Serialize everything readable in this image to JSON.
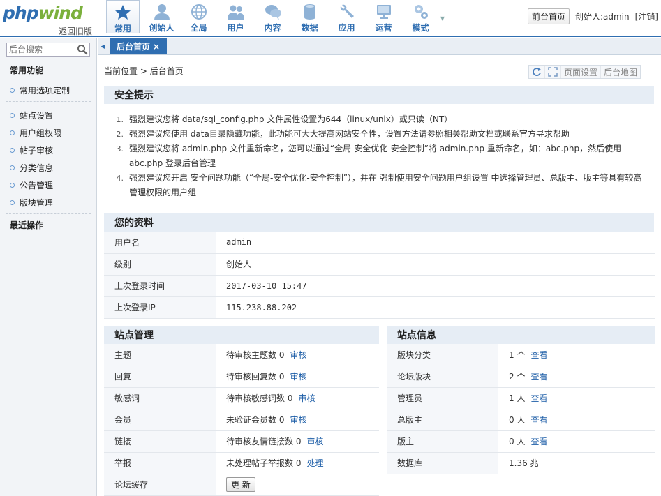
{
  "header": {
    "logo_main": "phpwind",
    "logo_sub": "返回旧版",
    "nav": [
      {
        "label": "常用",
        "icon": "star-icon",
        "active": true
      },
      {
        "label": "创始人",
        "icon": "person-icon"
      },
      {
        "label": "全局",
        "icon": "globe-icon"
      },
      {
        "label": "用户",
        "icon": "users-icon"
      },
      {
        "label": "内容",
        "icon": "chat-icon"
      },
      {
        "label": "数据",
        "icon": "database-icon"
      },
      {
        "label": "应用",
        "icon": "wrench-icon"
      },
      {
        "label": "运营",
        "icon": "monitor-icon"
      },
      {
        "label": "模式",
        "icon": "gears-icon"
      }
    ],
    "front_button": "前台首页",
    "user_text": "创始人:admin",
    "logout": "[注销]"
  },
  "sidebar": {
    "search_placeholder": "后台搜索",
    "section_title": "常用功能",
    "custom_item": "常用选项定制",
    "items": [
      "站点设置",
      "用户组权限",
      "帖子审核",
      "分类信息",
      "公告管理",
      "版块管理"
    ],
    "recent_title": "最近操作"
  },
  "tabbar": {
    "tab_label": "后台首页",
    "close": "×"
  },
  "breadcrumb": {
    "current": "当前位置",
    "sep": ">",
    "page": "后台首页"
  },
  "tools": {
    "page_settings": "页面设置",
    "site_map": "后台地图"
  },
  "security": {
    "title": "安全提示",
    "tips": [
      {
        "num": "1.",
        "text": "强烈建议您将 data/sql_config.php 文件属性设置为644（linux/unix）或只读（NT）"
      },
      {
        "num": "2.",
        "text": "强烈建议您使用 data目录隐藏功能，此功能可大大提高网站安全性，设置方法请参照相关帮助文档或联系官方寻求帮助"
      },
      {
        "num": "3.",
        "text": "强烈建议您将 admin.php 文件重新命名，您可以通过“全局-安全优化-安全控制”将 admin.php 重新命名，如：abc.php，然后使用 abc.php 登录后台管理"
      },
      {
        "num": "4.",
        "text": "强烈建议您开启 安全问题功能（“全局-安全优化-安全控制”），并在 强制使用安全问题用户组设置 中选择管理员、总版主、版主等具有较高管理权限的用户组"
      }
    ]
  },
  "profile": {
    "title": "您的资料",
    "rows": [
      {
        "label": "用户名",
        "value": "admin"
      },
      {
        "label": "级别",
        "value": "创始人"
      },
      {
        "label": "上次登录时间",
        "value": "2017-03-10 15:47"
      },
      {
        "label": "上次登录IP",
        "value": "115.238.88.202"
      }
    ]
  },
  "site_manage": {
    "title": "站点管理",
    "rows": [
      {
        "label": "主题",
        "value": "待审核主题数 0",
        "action": "审核"
      },
      {
        "label": "回复",
        "value": "待审核回复数 0",
        "action": "审核"
      },
      {
        "label": "敏感词",
        "value": "待审核敏感词数 0",
        "action": "审核"
      },
      {
        "label": "会员",
        "value": "未验证会员数 0",
        "action": "审核"
      },
      {
        "label": "链接",
        "value": "待审核友情链接数 0",
        "action": "审核"
      },
      {
        "label": "举报",
        "value": "未处理帖子举报数 0",
        "action": "处理"
      }
    ],
    "cache_label": "论坛缓存",
    "cache_button": "更 新"
  },
  "site_info": {
    "title": "站点信息",
    "rows": [
      {
        "label": "版块分类",
        "value": "1 个",
        "action": "查看"
      },
      {
        "label": "论坛版块",
        "value": "2 个",
        "action": "查看"
      },
      {
        "label": "管理员",
        "value": "1 人",
        "action": "查看"
      },
      {
        "label": "总版主",
        "value": "0 人",
        "action": "查看"
      },
      {
        "label": "版主",
        "value": "0 人",
        "action": "查看"
      },
      {
        "label": "数据库",
        "value": "1.36 兆",
        "action": ""
      }
    ]
  }
}
